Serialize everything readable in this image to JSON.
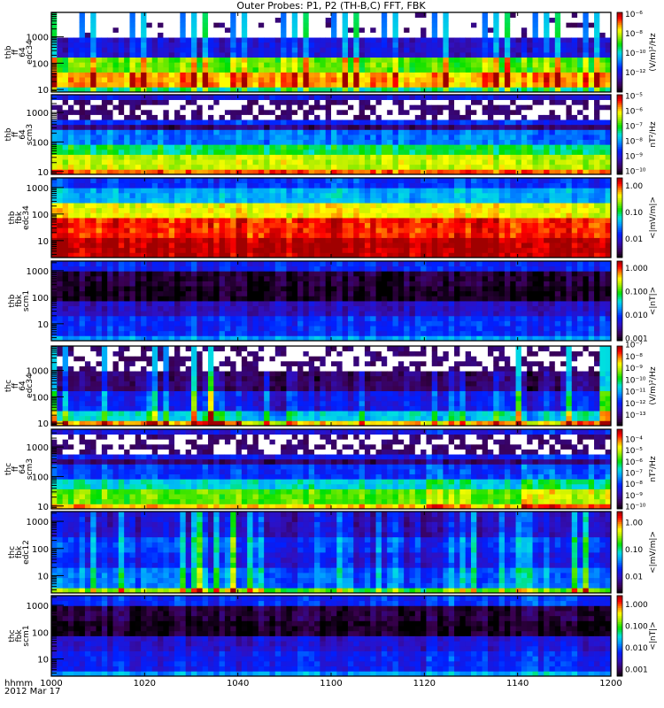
{
  "title": "Outer Probes: P1, P2 (TH-B,C) FFT, FBK",
  "x_axis": {
    "label_line1": "hhmm",
    "label_line2": "2012 Mar 17",
    "tick_labels": [
      "1000",
      "1020",
      "1040",
      "1100",
      "1120",
      "1140",
      "1200"
    ],
    "range_minutes": [
      0,
      120
    ]
  },
  "chart_data": {
    "type": "heatmap",
    "title": "Outer Probes: P1, P2 (TH-B,C) FFT, FBK",
    "xlabel": "hhmm 2012 Mar 17",
    "panels": [
      {
        "id": "thb-ff-edc34",
        "label_lines": [
          "thb",
          "ff",
          "64",
          "edc34"
        ],
        "ylabel_ticks": [
          "10",
          "100",
          "1000"
        ],
        "yrange_hz": [
          8,
          8500
        ],
        "colorbar": {
          "unit": "(V/m)²/Hz",
          "zrange_log": [
            -14,
            -5.8
          ],
          "ticks": [
            {
              "label": "10⁻⁶",
              "log": -6
            },
            {
              "label": "10⁻⁸",
              "log": -8
            },
            {
              "label": "10⁻¹⁰",
              "log": -10
            },
            {
              "label": "10⁻¹²",
              "log": -12
            }
          ]
        },
        "pattern": "periodic",
        "period_min": 2.7,
        "bands": [
          {
            "to": 12,
            "level": 0.6
          },
          {
            "to": 50,
            "level": 0.9
          },
          {
            "to": 200,
            "level": 0.72
          },
          {
            "to": 1000,
            "level": 0.3
          },
          {
            "to": 9000,
            "level": -1
          }
        ],
        "activity": [
          1,
          1,
          1,
          1,
          1,
          1,
          1,
          1,
          1,
          1,
          1,
          1
        ]
      },
      {
        "id": "thb-ff-scm3",
        "label_lines": [
          "thb",
          "ff",
          "64",
          "scm3"
        ],
        "ylabel_ticks": [
          "10",
          "100",
          "1000"
        ],
        "yrange_hz": [
          8,
          4000
        ],
        "colorbar": {
          "unit": "nT²/Hz",
          "zrange_log": [
            -10.2,
            -4.9
          ],
          "ticks": [
            {
              "label": "10⁻⁵",
              "log": -5
            },
            {
              "label": "10⁻⁶",
              "log": -6
            },
            {
              "label": "10⁻⁷",
              "log": -7
            },
            {
              "label": "10⁻⁸",
              "log": -8
            },
            {
              "label": "10⁻⁹",
              "log": -9
            },
            {
              "label": "10⁻¹⁰",
              "log": -10
            }
          ]
        },
        "pattern": "steady",
        "bands": [
          {
            "to": 11,
            "level": 0.88
          },
          {
            "to": 35,
            "level": 0.73
          },
          {
            "to": 70,
            "level": 0.57
          },
          {
            "to": 250,
            "level": 0.38
          },
          {
            "to": 450,
            "level": 0.12
          },
          {
            "to": 550,
            "level": 0.3
          },
          {
            "to": 3000,
            "level": -0.5
          },
          {
            "to": 4000,
            "level": 0.25
          }
        ],
        "activity": [
          1,
          1,
          1,
          1,
          1,
          1,
          1,
          1,
          1,
          1,
          1,
          1
        ]
      },
      {
        "id": "thb-fbk-edc34",
        "label_lines": [
          "thb",
          "fbk",
          "edc34"
        ],
        "ylabel_ticks": [
          "10",
          "100",
          "1000"
        ],
        "yrange_hz": [
          2.3,
          2300
        ],
        "colorbar": {
          "unit": "<|mV/m|>",
          "zrange_log": [
            -2.7,
            0.3
          ],
          "ticks": [
            {
              "label": "1.00",
              "log": 0
            },
            {
              "label": "0.10",
              "log": -1
            },
            {
              "label": "0.01",
              "log": -2
            }
          ]
        },
        "pattern": "steady",
        "bands": [
          {
            "to": 15,
            "level": 0.99
          },
          {
            "to": 70,
            "level": 0.92
          },
          {
            "to": 250,
            "level": 0.77
          },
          {
            "to": 1100,
            "level": 0.44
          },
          {
            "to": 2300,
            "level": 0.31
          }
        ],
        "activity": [
          1,
          1,
          1,
          1,
          1,
          1,
          1,
          1,
          1,
          1,
          1,
          1
        ]
      },
      {
        "id": "thb-fbk-scm1",
        "label_lines": [
          "thb",
          "fbk",
          "scm1"
        ],
        "ylabel_ticks": [
          "10",
          "100",
          "1000"
        ],
        "yrange_hz": [
          2.3,
          2300
        ],
        "colorbar": {
          "unit": "<|nT|>",
          "zrange_log": [
            -3.1,
            0.3
          ],
          "ticks": [
            {
              "label": "1.000",
              "log": 0
            },
            {
              "label": "0.100",
              "log": -1
            },
            {
              "label": "0.010",
              "log": -2
            },
            {
              "label": "0.001",
              "log": -3
            }
          ]
        },
        "pattern": "steady",
        "bands": [
          {
            "to": 4,
            "level": 0.42
          },
          {
            "to": 17,
            "level": 0.3
          },
          {
            "to": 60,
            "level": 0.2
          },
          {
            "to": 250,
            "level": 0.02
          },
          {
            "to": 1100,
            "level": 0.05
          },
          {
            "to": 2300,
            "level": 0.28
          }
        ],
        "activity": [
          1,
          1,
          1,
          1,
          1,
          1,
          1,
          1,
          1,
          1,
          1,
          1
        ]
      },
      {
        "id": "thc-ff-edc34",
        "label_lines": [
          "thc",
          "ff",
          "64",
          "edc34"
        ],
        "ylabel_ticks": [
          "10",
          "100",
          "1000"
        ],
        "yrange_hz": [
          8,
          8500
        ],
        "colorbar": {
          "unit": "(V/m)²/Hz",
          "zrange_log": [
            -13.9,
            -7.1
          ],
          "ticks": [
            {
              "label": "10⁻⁷",
              "log": -7
            },
            {
              "label": "10⁻⁸",
              "log": -8
            },
            {
              "label": "10⁻⁹",
              "log": -9
            },
            {
              "label": "10⁻¹⁰",
              "log": -10
            },
            {
              "label": "10⁻¹¹",
              "log": -11
            },
            {
              "label": "10⁻¹²",
              "log": -12
            },
            {
              "label": "10⁻¹³",
              "log": -13
            }
          ]
        },
        "pattern": "bursty",
        "bands": [
          {
            "to": 10,
            "level": 0.92
          },
          {
            "to": 30,
            "level": 0.58
          },
          {
            "to": 200,
            "level": 0.36
          },
          {
            "to": 1000,
            "level": 0.2
          },
          {
            "to": 9000,
            "level": -0.6
          }
        ],
        "activity": [
          1.1,
          1.0,
          1.0,
          1.5,
          0.6,
          0.9,
          0.8,
          1.0,
          0.7,
          1.1,
          0.6,
          1.2
        ]
      },
      {
        "id": "thc-ff-scm3",
        "label_lines": [
          "thc",
          "ff",
          "64",
          "scm3"
        ],
        "ylabel_ticks": [
          "10",
          "100",
          "1000"
        ],
        "yrange_hz": [
          8,
          4000
        ],
        "colorbar": {
          "unit": "nT²/Hz",
          "zrange_log": [
            -10.2,
            -3.1
          ],
          "ticks": [
            {
              "label": "10⁻⁴",
              "log": -4
            },
            {
              "label": "10⁻⁵",
              "log": -5
            },
            {
              "label": "10⁻⁶",
              "log": -6
            },
            {
              "label": "10⁻⁷",
              "log": -7
            },
            {
              "label": "10⁻⁸",
              "log": -8
            },
            {
              "label": "10⁻⁹",
              "log": -9
            },
            {
              "label": "10⁻¹⁰",
              "log": -10
            }
          ]
        },
        "pattern": "steady",
        "bands": [
          {
            "to": 11,
            "level": 0.82
          },
          {
            "to": 35,
            "level": 0.66
          },
          {
            "to": 70,
            "level": 0.5
          },
          {
            "to": 250,
            "level": 0.32
          },
          {
            "to": 450,
            "level": 0.12
          },
          {
            "to": 550,
            "level": 0.28
          },
          {
            "to": 2500,
            "level": -0.5
          },
          {
            "to": 4000,
            "level": 0.25
          }
        ],
        "activity": [
          1,
          1,
          1,
          1,
          1,
          1,
          1,
          1,
          1.1,
          1,
          1.15,
          1.1
        ]
      },
      {
        "id": "thc-fbk-edc12",
        "label_lines": [
          "thc",
          "fbk",
          "edc12"
        ],
        "ylabel_ticks": [
          "10",
          "100",
          "1000"
        ],
        "yrange_hz": [
          2.3,
          2300
        ],
        "colorbar": {
          "unit": "<|mV/m|>",
          "zrange_log": [
            -2.6,
            0.4
          ],
          "ticks": [
            {
              "label": "1.00",
              "log": 0
            },
            {
              "label": "0.10",
              "log": -1
            },
            {
              "label": "0.01",
              "log": -2
            }
          ]
        },
        "pattern": "bursty",
        "bands": [
          {
            "to": 4,
            "level": 0.75
          },
          {
            "to": 17,
            "level": 0.45
          },
          {
            "to": 60,
            "level": 0.35
          },
          {
            "to": 250,
            "level": 0.4
          },
          {
            "to": 1100,
            "level": 0.3
          },
          {
            "to": 2300,
            "level": 0.3
          }
        ],
        "activity": [
          1.0,
          1.2,
          1.1,
          1.3,
          1.0,
          0.6,
          0.7,
          0.6,
          1.0,
          0.9,
          1.0,
          1.0
        ]
      },
      {
        "id": "thc-fbk-scm1",
        "label_lines": [
          "thc",
          "fbk",
          "scm1"
        ],
        "ylabel_ticks": [
          "10",
          "100",
          "1000"
        ],
        "yrange_hz": [
          2.3,
          2300
        ],
        "colorbar": {
          "unit": "<|nT|>",
          "zrange_log": [
            -3.3,
            0.4
          ],
          "ticks": [
            {
              "label": "1.000",
              "log": 0
            },
            {
              "label": "0.100",
              "log": -1
            },
            {
              "label": "0.010",
              "log": -2
            },
            {
              "label": "0.001",
              "log": -3
            }
          ]
        },
        "pattern": "steady",
        "bands": [
          {
            "to": 4,
            "level": 0.42
          },
          {
            "to": 17,
            "level": 0.27
          },
          {
            "to": 60,
            "level": 0.22
          },
          {
            "to": 250,
            "level": 0.03
          },
          {
            "to": 1100,
            "level": 0.06
          },
          {
            "to": 2300,
            "level": 0.3
          }
        ],
        "activity": [
          1,
          1,
          1,
          1,
          1,
          1,
          1,
          1,
          1.1,
          1.05,
          1.1,
          1.05
        ]
      }
    ]
  }
}
